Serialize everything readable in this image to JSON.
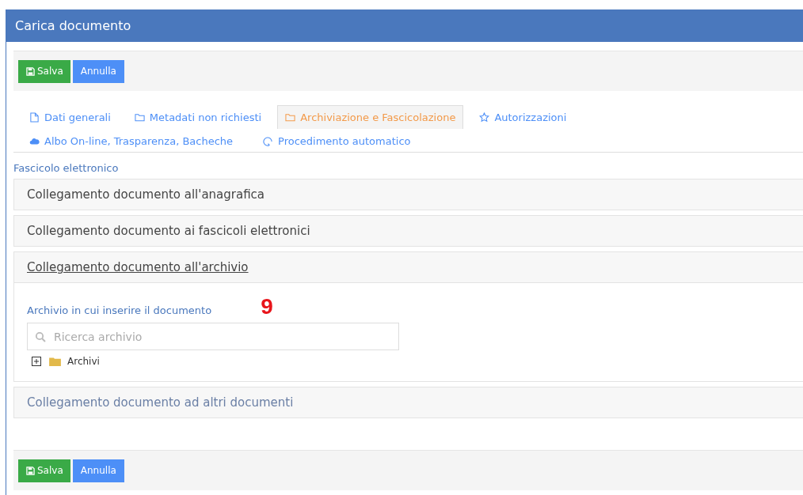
{
  "window": {
    "title": "Carica documento"
  },
  "top_toolbar": {
    "buttons": [
      {
        "kind": "save",
        "label": "Salva"
      },
      {
        "kind": "cancel",
        "label": "Annulla"
      }
    ]
  },
  "tabs": [
    {
      "label": "Dati generali",
      "kind": "file",
      "selected": false
    },
    {
      "label": "Metadati non richiesti",
      "kind": "folder",
      "selected": false
    },
    {
      "label": "Archiviazione e Fascicolazione",
      "kind": "folder",
      "selected": true
    },
    {
      "label": "Autorizzazioni",
      "kind": "star",
      "selected": false
    },
    {
      "label": "Albo On-line, Trasparenza, Bacheche",
      "kind": "cloud",
      "selected": false
    },
    {
      "label": "Procedimento automatico",
      "kind": "refresh",
      "selected": false
    }
  ],
  "section_label": "Fascicolo elettronico",
  "panels": [
    {
      "title": "Collegamento documento all'anagrafica",
      "expanded": false,
      "hovered": false
    },
    {
      "title": "Collegamento documento ai fascicoli elettronici",
      "expanded": false,
      "hovered": false
    },
    {
      "title": "Collegamento documento all'archivio",
      "expanded": true,
      "hovered": false,
      "body": {
        "label": "Archivio in cui inserire il documento",
        "annotation": "9",
        "search": {
          "placeholder": "Ricerca archivio"
        },
        "tree": [
          {
            "label": "Archivi",
            "expanded": false
          }
        ]
      }
    },
    {
      "title": "Collegamento documento ad altri documenti",
      "expanded": false,
      "hovered": true
    }
  ],
  "bottom_toolbar": {
    "buttons": [
      {
        "kind": "save",
        "label": "Salva"
      },
      {
        "kind": "cancel",
        "label": "Annulla"
      }
    ]
  }
}
